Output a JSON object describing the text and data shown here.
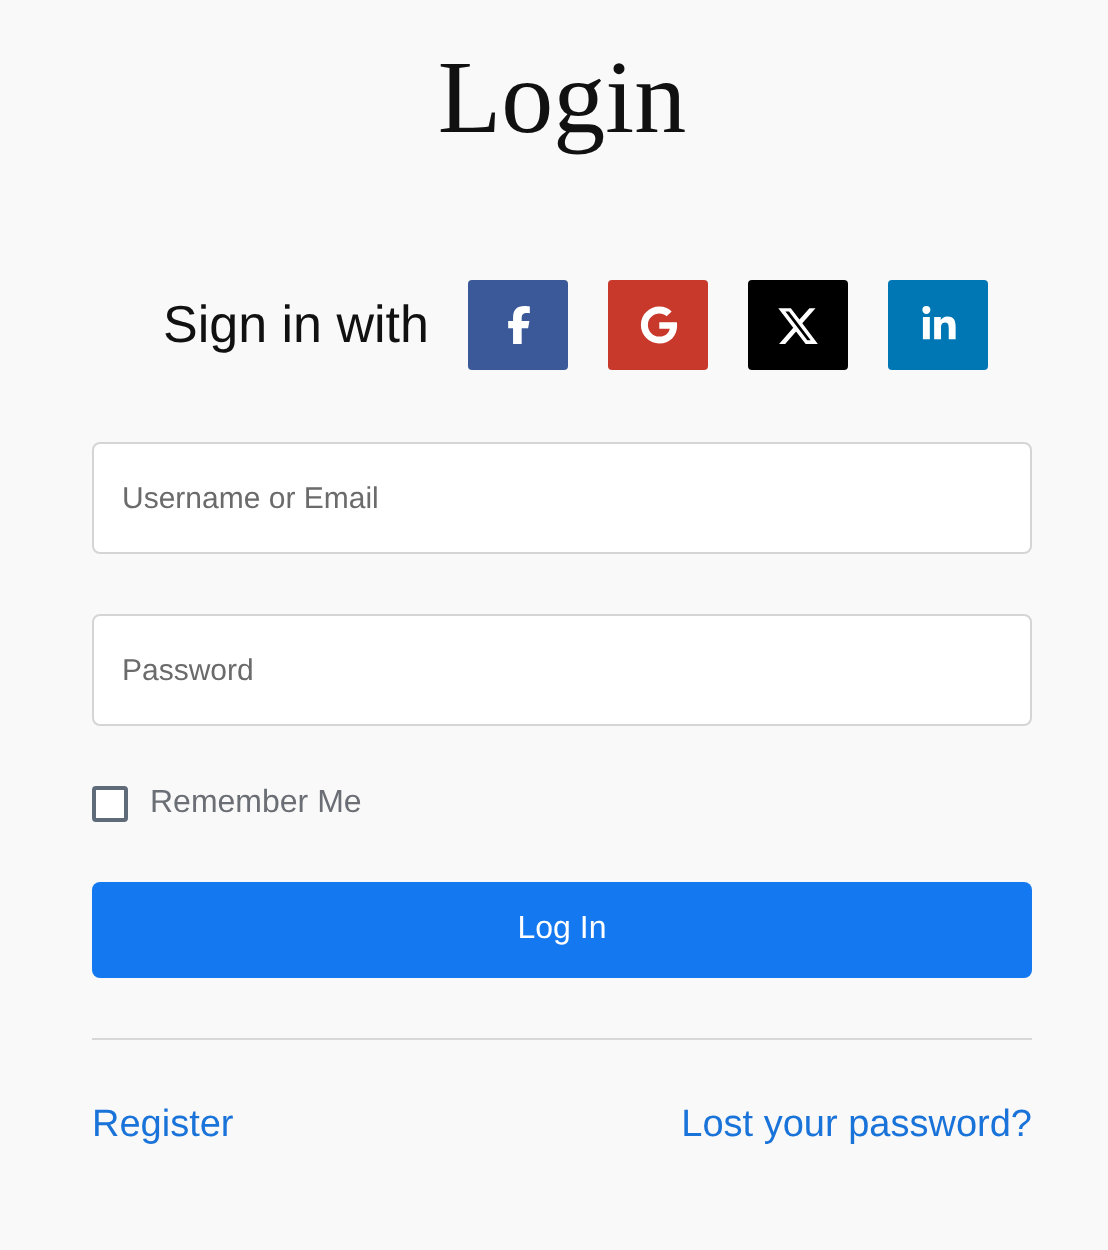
{
  "title": "Login",
  "social": {
    "label": "Sign in with",
    "providers": [
      {
        "kind": "facebook",
        "color": "#3b5998"
      },
      {
        "kind": "google",
        "color": "#c8392b"
      },
      {
        "kind": "x",
        "color": "#000000"
      },
      {
        "kind": "linkedin",
        "color": "#0077b5"
      }
    ]
  },
  "fields": [
    {
      "placeholder": "Username or Email"
    },
    {
      "placeholder": "Password"
    }
  ],
  "remember": {
    "label": "Remember Me",
    "checked": false
  },
  "submit": "Log In",
  "links": {
    "register": "Register",
    "lost_password": "Lost your password?"
  }
}
